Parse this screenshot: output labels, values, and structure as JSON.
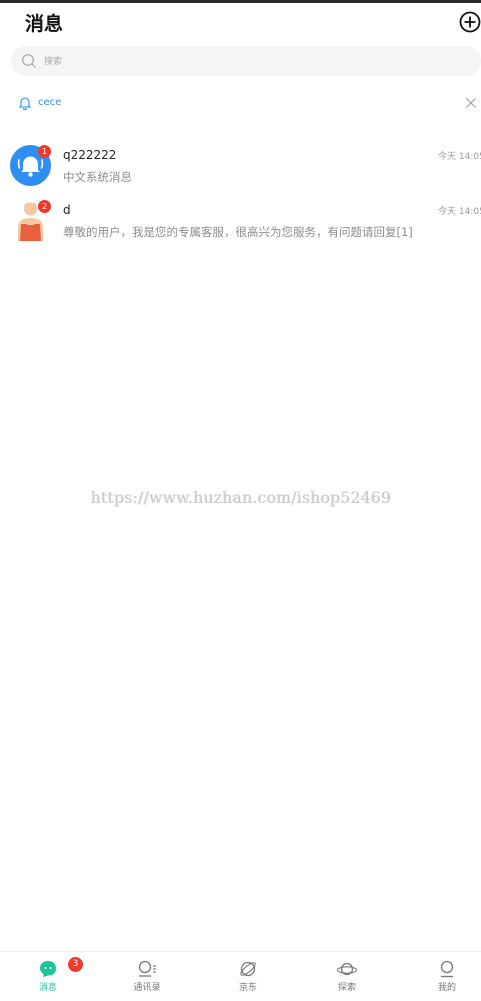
{
  "header": {
    "title": "消息"
  },
  "search": {
    "placeholder": "搜索"
  },
  "notice": {
    "text": "cece"
  },
  "messages": [
    {
      "name": "q222222",
      "time": "今天 14:05",
      "preview": "中文系统消息",
      "badge": "1"
    },
    {
      "name": "d",
      "time": "今天 14:05",
      "preview": "尊敬的用户，我是您的专属客服，很高兴为您服务，有问题请回复[1]",
      "badge": "2"
    }
  ],
  "watermark": "https://www.huzhan.com/ishop52469",
  "tabs": [
    {
      "label": "消息",
      "icon": "chat-bubble-icon",
      "active": true
    },
    {
      "label": "通讯录",
      "icon": "contacts-icon"
    },
    {
      "label": "京东",
      "icon": "planet-ring-icon"
    },
    {
      "label": "探索",
      "icon": "saturn-icon"
    },
    {
      "label": "我的",
      "icon": "profile-icon"
    }
  ],
  "tab_badge": "3",
  "colors": {
    "accent": "#20c49a",
    "link": "#2f8ef0",
    "badge": "#f0392a",
    "system_avatar": "#2f8ef0"
  }
}
